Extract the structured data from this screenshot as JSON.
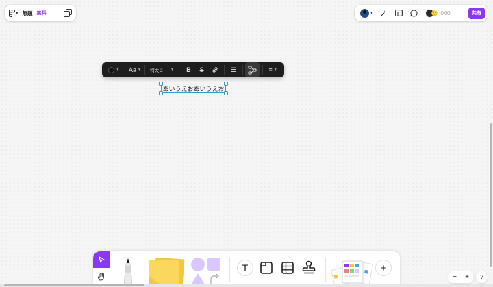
{
  "colors": {
    "accent": "#8a38f5",
    "selection": "#2b9bd1",
    "toolbar_bg": "#1e1e1e"
  },
  "header": {
    "logo_icon": "figjam-logo-icon",
    "file_name": "無題",
    "plan_badge": "無料",
    "timer": "0:00",
    "share_label": "共有"
  },
  "text_toolbar": {
    "font_label": "Aa",
    "font_size": "特大 2",
    "bold": "B",
    "strike": "S",
    "list": "☰",
    "align": "≡"
  },
  "canvas": {
    "selected_text": "あいうえおあいうえお"
  },
  "bottom_toolbar": {
    "text_tool": "T",
    "add_label": "+"
  },
  "zoom": {
    "minus": "−",
    "plus": "+"
  },
  "help": "?"
}
